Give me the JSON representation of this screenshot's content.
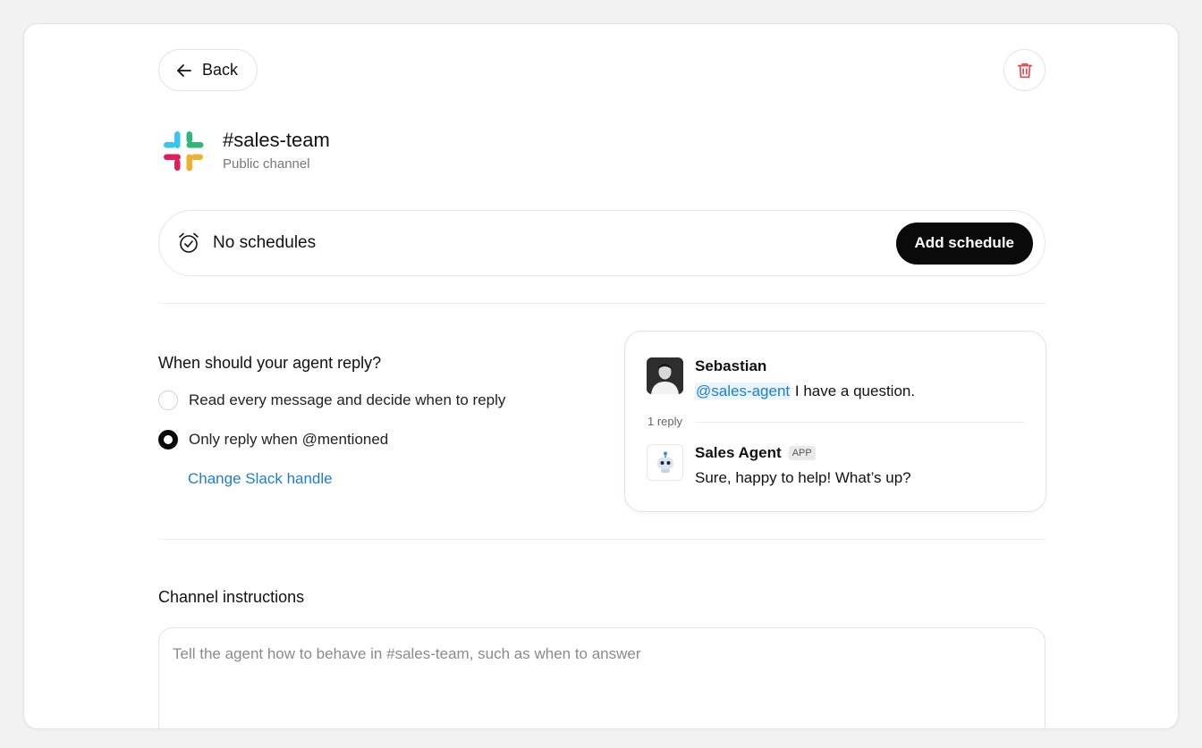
{
  "header": {
    "back_label": "Back"
  },
  "channel": {
    "name": "#sales-team",
    "type": "Public channel"
  },
  "schedule": {
    "status": "No schedules",
    "add_label": "Add schedule"
  },
  "reply": {
    "question": "When should your agent reply?",
    "options": [
      {
        "label": "Read every message and decide when to reply",
        "selected": false
      },
      {
        "label": "Only reply when @mentioned",
        "selected": true
      }
    ],
    "change_handle": "Change Slack handle"
  },
  "preview": {
    "user_name": "Sebastian",
    "mention": "@sales-agent",
    "user_text": " I have a question.",
    "reply_count": "1 reply",
    "bot_name": "Sales Agent",
    "bot_badge": "APP",
    "bot_text": "Sure, happy to help! What’s up?"
  },
  "instructions": {
    "label": "Channel instructions",
    "placeholder": "Tell the agent how to behave in #sales-team, such as when to answer",
    "value": ""
  },
  "colors": {
    "accent_link": "#1a7fd1",
    "danger": "#e5484d",
    "primary_button": "#0a0a0a",
    "slack_blue": "#36C5F0",
    "slack_green": "#2EB67D",
    "slack_red": "#E01E5A",
    "slack_yellow": "#ECB22E"
  },
  "icons": [
    "arrow-left-icon",
    "trash-icon",
    "slack-logo-icon",
    "alarm-clock-icon",
    "robot-icon"
  ]
}
